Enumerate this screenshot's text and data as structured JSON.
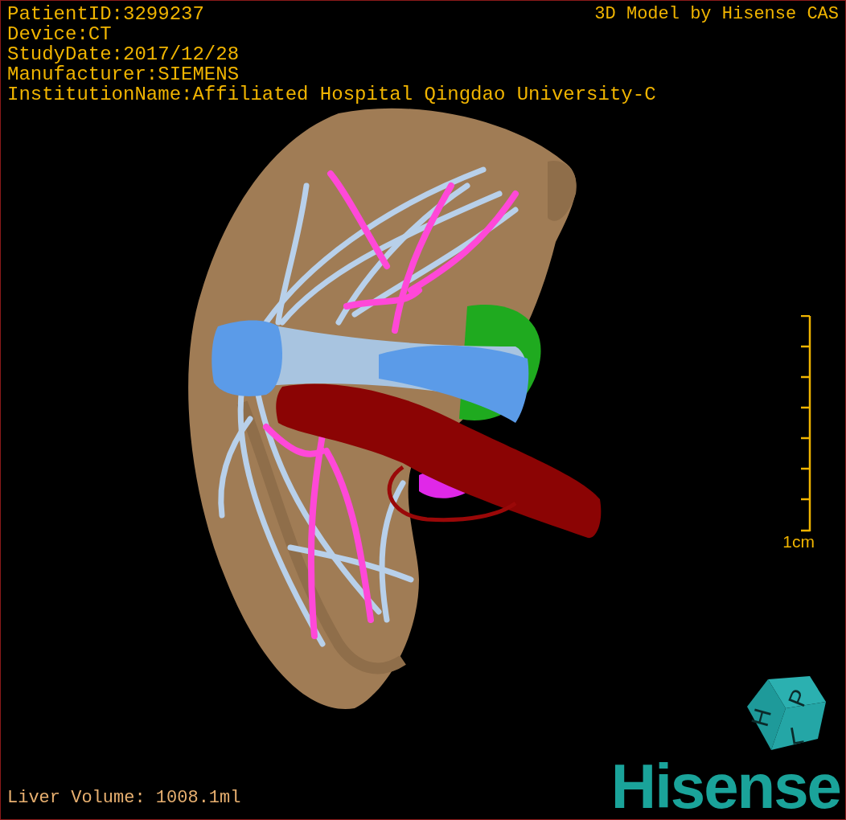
{
  "header": {
    "patient_info": [
      "PatientID:3299237",
      "Device:CT",
      "StudyDate:2017/12/28",
      "Manufacturer:SIEMENS",
      "InstitutionName:Affiliated Hospital Qingdao University-C"
    ],
    "title": "3D Model by Hisense CAS"
  },
  "scale_bar": {
    "label": "1cm"
  },
  "footer": {
    "liver_volume": "Liver Volume: 1008.1ml",
    "orientation_cube": [
      "H",
      "P",
      "L"
    ],
    "logo": "Hisense"
  }
}
